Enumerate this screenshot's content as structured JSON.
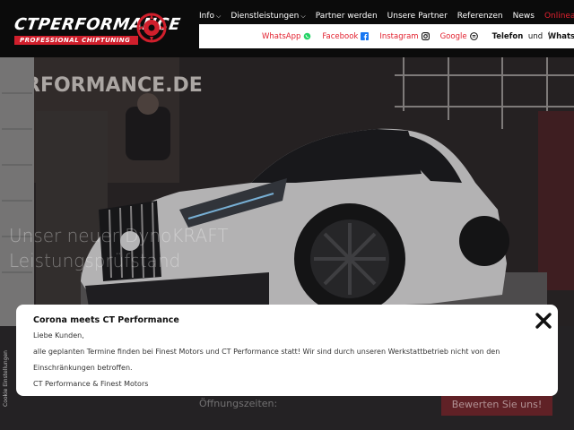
{
  "logo": {
    "brand_ct": "CT",
    "brand_rest": "PERFORMANCE",
    "tagline": "PROFESSIONAL CHIPTUNING"
  },
  "nav": {
    "items": [
      {
        "label": "Info",
        "has_dropdown": true
      },
      {
        "label": "Dienstleistungen",
        "has_dropdown": true
      },
      {
        "label": "Partner werden",
        "has_dropdown": false
      },
      {
        "label": "Unsere Partner",
        "has_dropdown": false
      },
      {
        "label": "Referenzen",
        "has_dropdown": false
      },
      {
        "label": "News",
        "has_dropdown": false
      }
    ],
    "highlight": "Onlineanfrage"
  },
  "social": {
    "whatsapp": "WhatsApp",
    "facebook": "Facebook",
    "instagram": "Instagram",
    "google": "Google",
    "telefon": "Telefon",
    "und": "und",
    "whatsapp2": "WhatsApp"
  },
  "hero": {
    "wall_text": "RFORMANCE.DE",
    "title_line1": "Unser neuer DynoKRAFT",
    "title_line2": "Leistungsprüfstand"
  },
  "side": {
    "cookie": "Cookie Einstellungen"
  },
  "footer": {
    "opening": "Öffnungszeiten:",
    "review_button": "Bewerten Sie uns!"
  },
  "modal": {
    "title": "Corona meets CT Performance",
    "greeting": "Liebe Kunden,",
    "body": "alle geplanten Termine finden bei Finest Motors und CT Performance statt! Wir sind durch unseren Werkstattbetrieb nicht von den",
    "body2": "Einschränkungen betroffen.",
    "signoff": "CT Performance & Finest Motors"
  },
  "colors": {
    "accent": "#e2212f",
    "topbar": "#0b0b0b",
    "modal_bg": "#ffffff"
  },
  "icons": [
    "whatsapp-icon",
    "facebook-icon",
    "instagram-icon",
    "google-reviews-icon",
    "close-icon",
    "chevron-down-icon",
    "logo-emblem"
  ]
}
